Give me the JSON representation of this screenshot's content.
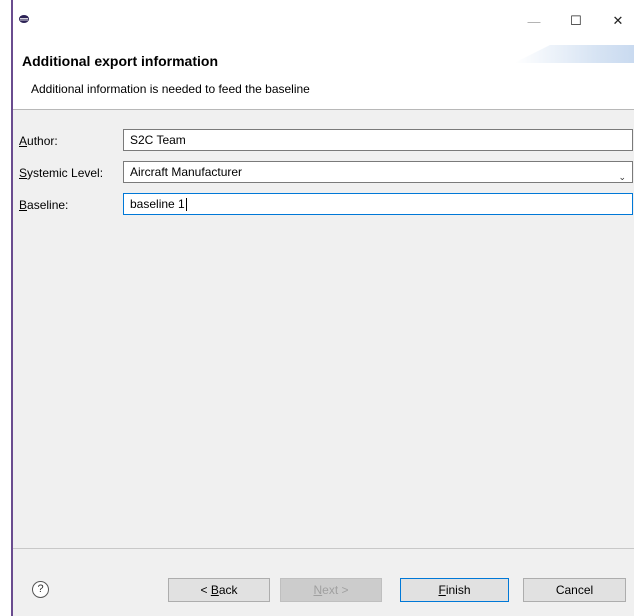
{
  "titlebar": {
    "minimize_glyph": "—",
    "maximize_glyph": "☐",
    "close_glyph": "✕"
  },
  "banner": {
    "title": "Additional export information",
    "description": "Additional information is needed to feed the baseline"
  },
  "form": {
    "author": {
      "label_mnemonic": "A",
      "label_rest": "uthor:",
      "value": "S2C Team"
    },
    "systemic_level": {
      "label_mnemonic": "S",
      "label_rest": "ystemic Level:",
      "value": "Aircraft Manufacturer"
    },
    "baseline": {
      "label_mnemonic": "B",
      "label_rest": "aseline:",
      "value": "baseline 1"
    }
  },
  "buttons": {
    "help": "?",
    "back": {
      "prefix": "< ",
      "mnemonic": "B",
      "rest": "ack"
    },
    "next": {
      "mnemonic": "N",
      "rest": "ext >"
    },
    "finish": {
      "mnemonic": "F",
      "rest": "inish"
    },
    "cancel": "Cancel"
  },
  "colors": {
    "window_bg": "#f0f0f0",
    "focus_border": "#0078d7",
    "frame_accent": "#6a4c8f"
  },
  "icons": [
    "app-icon",
    "minimize-icon",
    "maximize-icon",
    "close-icon",
    "chevron-down-icon",
    "help-icon"
  ]
}
